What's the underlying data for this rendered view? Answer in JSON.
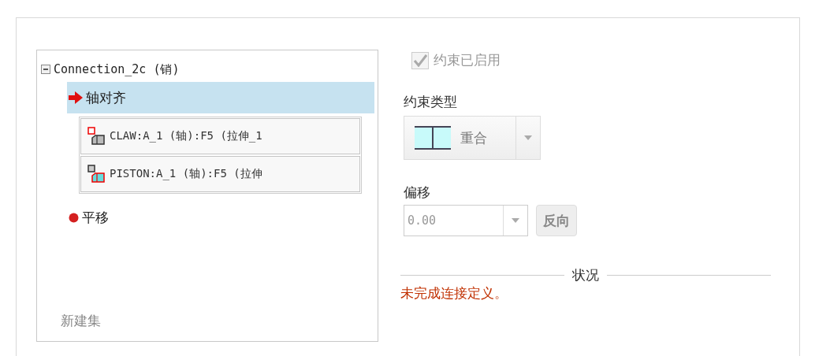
{
  "tree": {
    "label": "Connection_2c (销)",
    "expanded": true,
    "children": [
      {
        "label": "轴对齐",
        "kind": "current",
        "selected": true,
        "references": [
          {
            "label": "CLAW:A_1 (轴):F5 (拉伸_1",
            "kind": "small-part"
          },
          {
            "label": "PISTON:A_1 (轴):F5 (拉伸",
            "kind": "large-part"
          }
        ]
      },
      {
        "label": "平移",
        "kind": "incomplete",
        "selected": false
      }
    ],
    "new_set": "新建集"
  },
  "enabled_checkbox": {
    "label": "约束已启用",
    "checked": true,
    "disabled": true
  },
  "constraint_type": {
    "label": "约束类型",
    "value": "重合"
  },
  "offset": {
    "label": "偏移",
    "value": "0.00",
    "flip_button": "反向"
  },
  "status": {
    "title": "状况",
    "message": "未完成连接定义。"
  }
}
